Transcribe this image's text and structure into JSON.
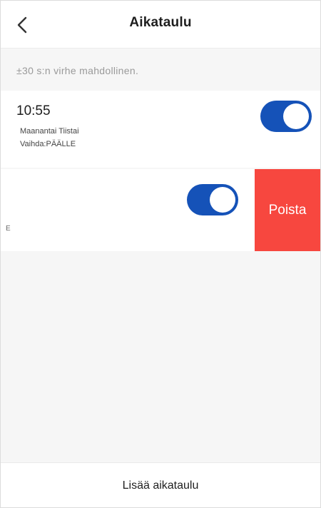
{
  "header": {
    "title": "Aikataulu",
    "back_icon": "chevron-left-icon"
  },
  "notice": "±30 s:n virhe mahdollinen.",
  "schedules": [
    {
      "time": "10:55",
      "days": "Maanantai Tiistai",
      "action": "Vaihda:PÄÄLLE",
      "enabled": true
    },
    {
      "partial_text": "E",
      "enabled": true,
      "delete_label": "Poista"
    }
  ],
  "footer": {
    "add_label": "Lisää aikataulu"
  },
  "colors": {
    "toggle_on": "#1552b8",
    "delete": "#f7473f",
    "background": "#f6f6f6"
  }
}
